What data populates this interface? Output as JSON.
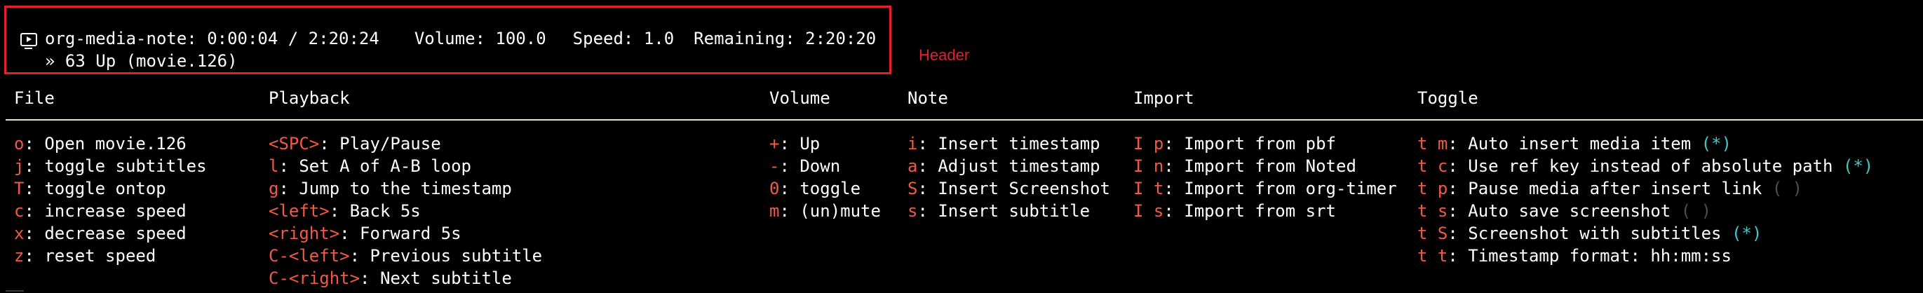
{
  "header": {
    "title": "org-media-note: 0:00:04 / 2:20:24",
    "volume": "Volume: 100.0",
    "speed": "Speed: 1.0",
    "remaining": "Remaining: 2:20:20",
    "subtitle": "» 63 Up (movie.126)",
    "annotation_label": "Header",
    "icon": "media-player-icon"
  },
  "colors": {
    "key": "#f15a45",
    "toggle_on": "#3fc8c8",
    "toggle_off": "#4e4e4e",
    "annotation": "#e4202b",
    "divider": "#e8e3c8"
  },
  "columns": [
    {
      "title": "File",
      "items": [
        {
          "key": "o",
          "label": ": Open movie.126"
        },
        {
          "key": "j",
          "label": ": toggle subtitles"
        },
        {
          "key": "T",
          "label": ": toggle ontop"
        },
        {
          "key": "c",
          "label": ": increase speed"
        },
        {
          "key": "x",
          "label": ": decrease speed"
        },
        {
          "key": "z",
          "label": ": reset speed"
        }
      ]
    },
    {
      "title": "Playback",
      "items": [
        {
          "key": "<SPC>",
          "label": ": Play/Pause"
        },
        {
          "key": "l",
          "label": ": Set A of A-B loop"
        },
        {
          "key": "g",
          "label": ": Jump to the timestamp"
        },
        {
          "key": "<left>",
          "label": ": Back 5s"
        },
        {
          "key": "<right>",
          "label": ": Forward 5s"
        },
        {
          "key": "C-<left>",
          "label": ": Previous subtitle"
        },
        {
          "key": "C-<right>",
          "label": ": Next subtitle"
        }
      ]
    },
    {
      "title": "Volume",
      "items": [
        {
          "key": "+",
          "label": ": Up"
        },
        {
          "key": "-",
          "label": ": Down"
        },
        {
          "key": "0",
          "label": ": toggle"
        },
        {
          "key": "m",
          "label": ": (un)mute"
        }
      ]
    },
    {
      "title": "Note",
      "items": [
        {
          "key": "i",
          "label": ": Insert timestamp"
        },
        {
          "key": "a",
          "label": ": Adjust timestamp"
        },
        {
          "key": "S",
          "label": ": Insert Screenshot"
        },
        {
          "key": "s",
          "label": ": Insert subtitle"
        }
      ]
    },
    {
      "title": "Import",
      "items": [
        {
          "key": "I p",
          "label": ": Import from pbf"
        },
        {
          "key": "I n",
          "label": ": Import from Noted"
        },
        {
          "key": "I t",
          "label": ": Import from org-timer"
        },
        {
          "key": "I s",
          "label": ": Import from srt"
        }
      ]
    },
    {
      "title": "Toggle",
      "items": [
        {
          "key": "t m",
          "label": ": Auto insert media item ",
          "state": "(*)",
          "on": true
        },
        {
          "key": "t c",
          "label": ": Use ref key instead of absolute path ",
          "state": "(*)",
          "on": true
        },
        {
          "key": "t p",
          "label": ": Pause media after insert link ",
          "state": "( )",
          "on": false
        },
        {
          "key": "t s",
          "label": ": Auto save screenshot ",
          "state": "( )",
          "on": false
        },
        {
          "key": "t S",
          "label": ": Screenshot with subtitles ",
          "state": "(*)",
          "on": true
        },
        {
          "key": "t t",
          "label": ": Timestamp format: hh:mm:ss"
        }
      ]
    }
  ]
}
